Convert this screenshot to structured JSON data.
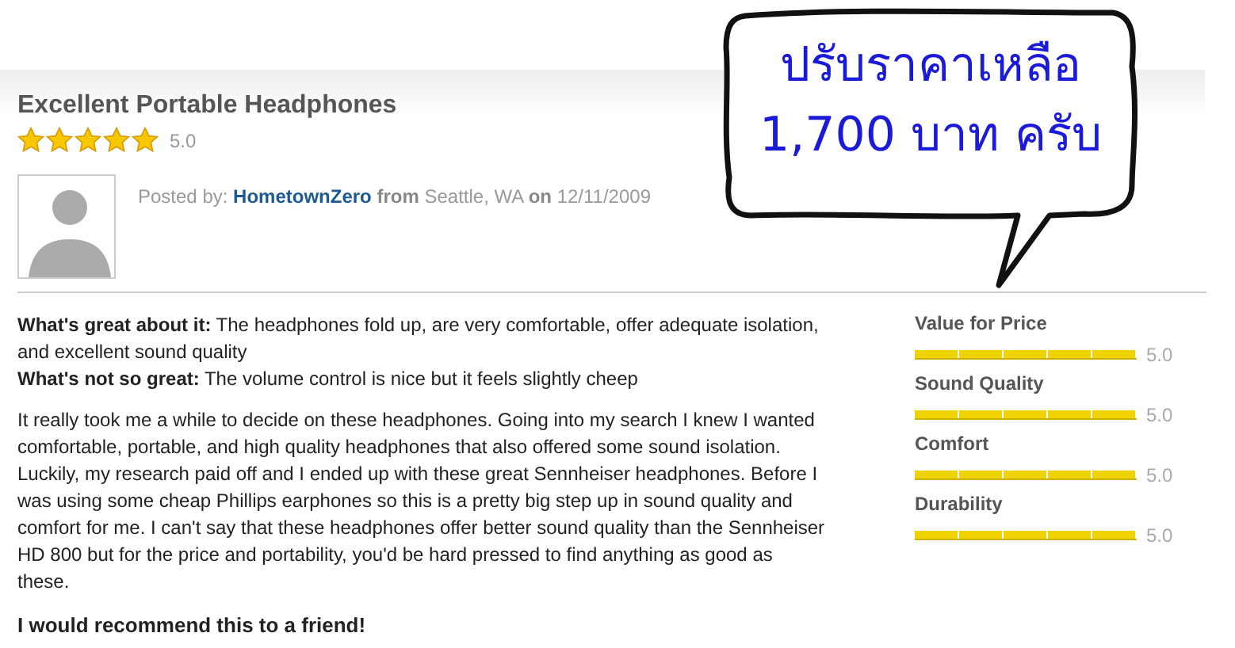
{
  "review": {
    "title": "Excellent Portable Headphones",
    "stars": 5,
    "score": "5.0",
    "posted": {
      "label": "Posted by:",
      "author": "HometownZero",
      "from": "from",
      "location": "Seattle, WA",
      "on": "on",
      "date": "12/11/2009"
    },
    "pros": "**What's great about it:** The headphones fold up, are very comfortable, offer adequate isolation, and excellent sound quality",
    "cons": "**What's not so great:** The volume control is nice but it feels slightly cheep",
    "body": "It really took me a while to decide on these headphones. Going into my search I knew I wanted comfortable, portable, and high quality headphones that also offered some sound isolation. Luckily, my research paid off and I ended up with these great Sennheiser headphones. Before I was using some cheap Phillips earphones so this is a pretty big step up in sound quality and comfort for me. I can't say that these headphones offer better sound quality than the Sennheiser HD 800 but for the price and portability, you'd be hard pressed to find anything as good as these.",
    "recommendation": "I would recommend this to a friend!"
  },
  "ratings": [
    {
      "label": "Value for Price",
      "level": 1,
      "reading": "5.0"
    },
    {
      "label": "Sound Quality",
      "level": 1,
      "reading": "5.0"
    },
    {
      "label": "Comfort",
      "level": 1,
      "reading": "5.0"
    },
    {
      "label": "Durability",
      "level": 1,
      "reading": "5.0"
    }
  ],
  "callout": {
    "lines": [
      "ปรับราคาเหลือ",
      "1,700 บาท ครับ"
    ]
  }
}
